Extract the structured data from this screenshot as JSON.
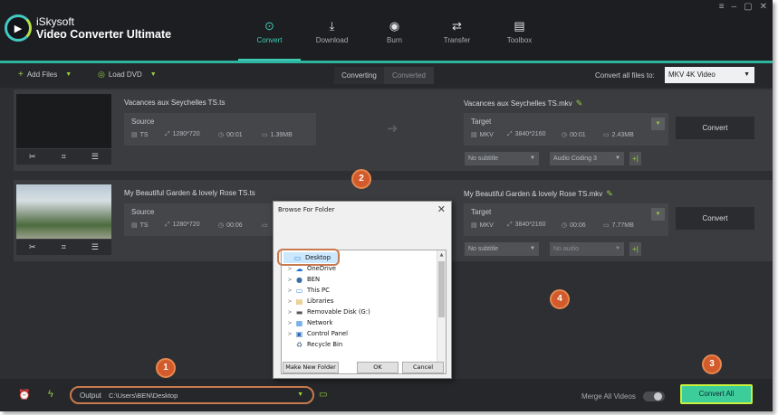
{
  "app": {
    "brand_name": "iSkysoft",
    "product_name": "Video Converter Ultimate",
    "window_controls": [
      "≡",
      "–",
      "▢",
      "✕"
    ]
  },
  "nav": {
    "tabs": [
      {
        "label": "Convert",
        "icon": "convert-icon",
        "active": true
      },
      {
        "label": "Download",
        "icon": "download-icon",
        "active": false
      },
      {
        "label": "Burn",
        "icon": "burn-icon",
        "active": false
      },
      {
        "label": "Transfer",
        "icon": "transfer-icon",
        "active": false
      },
      {
        "label": "Toolbox",
        "icon": "toolbox-icon",
        "active": false
      }
    ]
  },
  "toolbar": {
    "add_files": "Add Files",
    "load_dvd": "Load DVD",
    "converting": "Converting",
    "converted": "Converted",
    "convert_all_to_label": "Convert all files to:",
    "format": "MKV 4K Video"
  },
  "files": [
    {
      "source_title": "Vacances aux Seychelles TS.ts",
      "source_label": "Source",
      "source": {
        "format": "TS",
        "resolution": "1280*720",
        "duration": "00:01",
        "size": "1.39MB"
      },
      "target_title": "Vacances aux Seychelles TS.mkv",
      "target_label": "Target",
      "target": {
        "format": "MKV",
        "resolution": "3840*2160",
        "duration": "00:01",
        "size": "2.43MB"
      },
      "subtitle": "No subtitle",
      "audio": "Audio Coding 3",
      "convert_label": "Convert"
    },
    {
      "source_title": "My Beautiful Garden & lovely Rose TS.ts",
      "source_label": "Source",
      "source": {
        "format": "TS",
        "resolution": "1280*720",
        "duration": "00:06",
        "size": ""
      },
      "target_title": "My Beautiful Garden & lovely Rose TS.mkv",
      "target_label": "Target",
      "target": {
        "format": "MKV",
        "resolution": "3840*2160",
        "duration": "00:06",
        "size": "7.77MB"
      },
      "subtitle": "No subtitle",
      "audio": "No audio",
      "convert_label": "Convert"
    }
  ],
  "dialog": {
    "title": "Browse For Folder",
    "items": [
      {
        "label": "Desktop",
        "icon": "desktop-icon",
        "glyph": "▭",
        "color": "#2b7fd6",
        "expander": ""
      },
      {
        "label": "OneDrive",
        "icon": "onedrive-icon",
        "glyph": "☁",
        "color": "#1f6fd1",
        "expander": ">"
      },
      {
        "label": "BEN",
        "icon": "user-icon",
        "glyph": "●",
        "color": "#3a6ea5",
        "expander": ">"
      },
      {
        "label": "This PC",
        "icon": "pc-icon",
        "glyph": "▭",
        "color": "#3b8ede",
        "expander": ">"
      },
      {
        "label": "Libraries",
        "icon": "libraries-icon",
        "glyph": "▤",
        "color": "#d8a93c",
        "expander": ">"
      },
      {
        "label": "Removable Disk (G:)",
        "icon": "disk-icon",
        "glyph": "▬",
        "color": "#555555",
        "expander": ">"
      },
      {
        "label": "Network",
        "icon": "network-icon",
        "glyph": "▦",
        "color": "#3b8ede",
        "expander": ">"
      },
      {
        "label": "Control Panel",
        "icon": "control-panel-icon",
        "glyph": "▣",
        "color": "#2f6fb5",
        "expander": ">"
      },
      {
        "label": "Recycle Bin",
        "icon": "recycle-bin-icon",
        "glyph": "♻",
        "color": "#6b7a8a",
        "expander": ""
      }
    ],
    "make_new_folder": "Make New Folder",
    "ok": "OK",
    "cancel": "Cancel"
  },
  "bottom": {
    "output_label": "Output",
    "output_path": "C:\\Users\\BEN\\Desktop",
    "merge_label": "Merge All Videos",
    "merge_on": false,
    "convert_all": "Convert All"
  },
  "badges": [
    "1",
    "2",
    "3",
    "4"
  ],
  "colors": {
    "accent": "#3ccdb7",
    "green": "#9bd13f",
    "badge": "#d35a2a",
    "highlight_ring": "#c87a4e"
  }
}
